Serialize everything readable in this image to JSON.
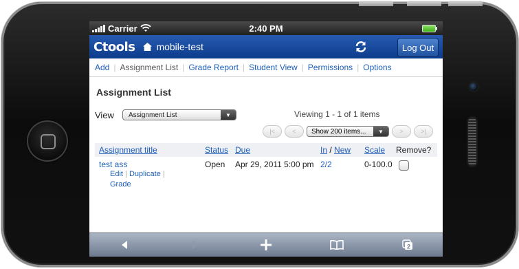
{
  "status_bar": {
    "carrier": "Carrier",
    "time": "2:40 PM"
  },
  "app_header": {
    "brand": "Ctools",
    "site_name": "mobile-test",
    "logout_label": "Log Out",
    "colors": {
      "bar": "#1a4fa3",
      "battery": "#5fd12f"
    }
  },
  "tool_nav": {
    "items": [
      "Add",
      "Assignment List",
      "Grade Report",
      "Student View",
      "Permissions",
      "Options"
    ]
  },
  "page": {
    "title": "Assignment List",
    "view_label": "View",
    "view_selected": "Assignment List",
    "viewing_text": "Viewing 1 - 1 of 1 items",
    "page_size_selected": "Show 200 items...",
    "pager_icons": [
      "first-page-icon",
      "prev-page-icon",
      "next-page-icon",
      "last-page-icon"
    ]
  },
  "table": {
    "headers": {
      "title": "Assignment title",
      "status": "Status",
      "due": "Due",
      "in": "In",
      "slash": "/",
      "new": "New",
      "scale": "Scale",
      "remove": "Remove?"
    },
    "rows": [
      {
        "title": "test ass",
        "action_edit": "Edit",
        "action_duplicate": "Duplicate",
        "action_grade": "Grade",
        "status": "Open",
        "due": "Apr 29, 2011 5:00 pm",
        "in_new": "2/2",
        "scale": "0-100.0"
      }
    ]
  },
  "toolbar": {
    "icons": [
      "back-arrow-icon",
      "forward-arrow-icon",
      "add-bookmark-icon",
      "bookmarks-book-icon",
      "pages-icon"
    ],
    "pages_count": "2"
  }
}
